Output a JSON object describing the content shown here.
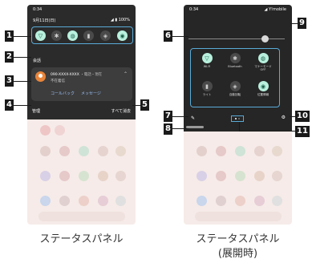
{
  "left_phone": {
    "status_time": "0:34",
    "status_right": "",
    "date": "9月11日(日)",
    "battery": "◢ ▮ 100%",
    "quick_tiles": [
      {
        "icon": "wifi-icon",
        "on": true
      },
      {
        "icon": "bluetooth-icon",
        "on": false
      },
      {
        "icon": "manner-mode-icon",
        "on": true
      },
      {
        "icon": "flashlight-icon",
        "on": false
      },
      {
        "icon": "auto-rotate-icon",
        "on": false
      },
      {
        "icon": "location-icon",
        "on": true
      }
    ],
    "section_label": "会話",
    "notification": {
      "caller": "090-XXXX-XXXX",
      "meta": "・電話・現在",
      "status": "不在着信",
      "action_callback": "コールバック",
      "action_message": "メッセージ"
    },
    "footer_manage": "管理",
    "footer_clear": "すべて消去"
  },
  "right_phone": {
    "status_time": "0:34",
    "carrier": "◢ Y!mobile",
    "tiles": [
      {
        "label": "Wi-Fi",
        "icon": "wifi-icon",
        "on": true
      },
      {
        "label": "Bluetooth",
        "icon": "bluetooth-icon",
        "on": false
      },
      {
        "label": "マナーモード\nOFF",
        "icon": "manner-mode-icon",
        "on": true
      },
      {
        "label": "ライト",
        "icon": "flashlight-icon",
        "on": false
      },
      {
        "label": "自動回転",
        "icon": "auto-rotate-icon",
        "on": false
      },
      {
        "label": "位置情報",
        "icon": "location-icon",
        "on": true
      }
    ]
  },
  "badges": {
    "b1": "1",
    "b2": "2",
    "b3": "3",
    "b4": "4",
    "b5": "5",
    "b6": "6",
    "b7": "7",
    "b8": "8",
    "b9": "9",
    "b10": "10",
    "b11": "11"
  },
  "captions": {
    "left": "ステータスパネル",
    "right_line1": "ステータスパネル",
    "right_line2": "(展開時)"
  },
  "colors": {
    "highlight": "#5aaad8",
    "tile_on": "#b8f0dd",
    "shade": "#2b2b2b",
    "badge": "#1a1a1a"
  }
}
